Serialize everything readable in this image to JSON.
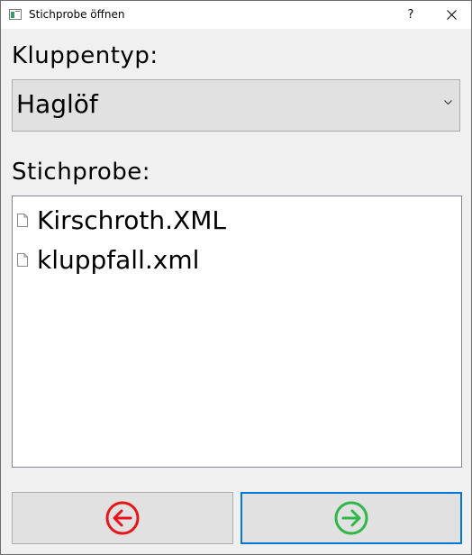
{
  "window": {
    "title": "Stichprobe öffnen",
    "help_label": "?",
    "icons": {
      "app": "app-icon",
      "close": "close-icon"
    }
  },
  "kluppentyp": {
    "label": "Kluppentyp:",
    "selected": "Haglöf",
    "icon": "chevron-down-icon"
  },
  "stichprobe": {
    "label": "Stichprobe:",
    "files": [
      {
        "name": "Kirschroth.XML",
        "icon": "file-icon"
      },
      {
        "name": "kluppfall.xml",
        "icon": "file-icon"
      }
    ]
  },
  "buttons": {
    "back": {
      "icon": "arrow-left-circle-icon",
      "color": "#e8141b"
    },
    "next": {
      "icon": "arrow-right-circle-icon",
      "color": "#2fb74a"
    },
    "focus_color": "#0078d7"
  }
}
